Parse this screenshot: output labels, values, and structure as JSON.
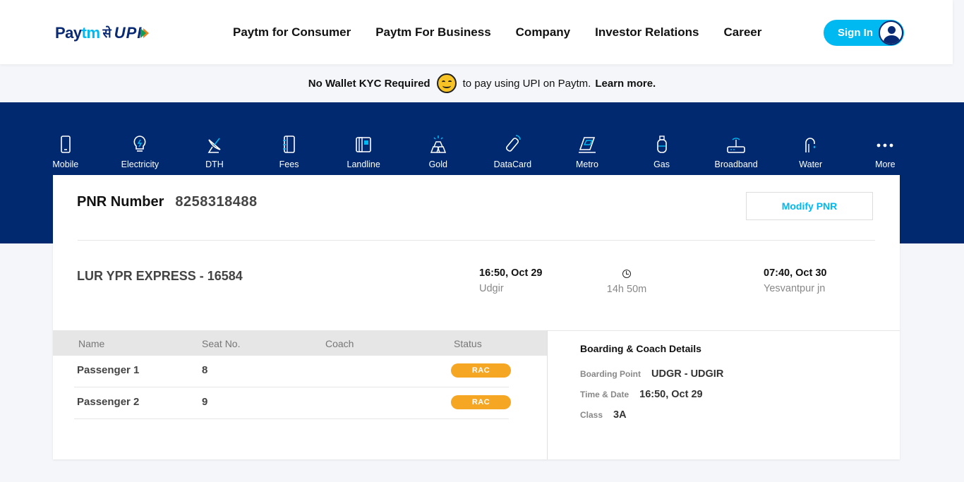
{
  "header": {
    "logo": {
      "brand": "Pay",
      "brand_tm": "tm",
      "se": "से",
      "upi": "UPI"
    },
    "nav": [
      "Paytm for Consumer",
      "Paytm For Business",
      "Company",
      "Investor Relations",
      "Career"
    ],
    "signin_label": "Sign In"
  },
  "kyc_banner": {
    "bold_text": "No Wallet KYC Required",
    "emoji": "smiley-icon",
    "mid_text": "to pay using UPI on Paytm.",
    "link_text": "Learn more."
  },
  "categories": [
    {
      "label": "Mobile",
      "icon": "mobile-icon"
    },
    {
      "label": "Electricity",
      "icon": "bulb-icon"
    },
    {
      "label": "DTH",
      "icon": "satellite-dish-icon"
    },
    {
      "label": "Fees",
      "icon": "notebook-icon"
    },
    {
      "label": "Landline",
      "icon": "landline-icon"
    },
    {
      "label": "Gold",
      "icon": "gold-icon"
    },
    {
      "label": "DataCard",
      "icon": "datacard-icon"
    },
    {
      "label": "Metro",
      "icon": "metro-icon"
    },
    {
      "label": "Gas",
      "icon": "gas-cylinder-icon"
    },
    {
      "label": "Broadband",
      "icon": "router-icon"
    },
    {
      "label": "Water",
      "icon": "water-tap-icon"
    },
    {
      "label": "More",
      "icon": "more-dots-icon"
    }
  ],
  "pnr": {
    "label": "PNR Number",
    "value": "8258318488",
    "modify_label": "Modify PNR"
  },
  "journey": {
    "train": "LUR YPR EXPRESS - 16584",
    "departure_time": "16:50, Oct 29",
    "departure_station": "Udgir",
    "duration": "14h 50m",
    "arrival_time": "07:40, Oct 30",
    "arrival_station": "Yesvantpur jn"
  },
  "passenger_table": {
    "headers": [
      "Name",
      "Seat No.",
      "Coach",
      "Status"
    ],
    "rows": [
      {
        "name": "Passenger 1",
        "seat": "8",
        "coach": "",
        "status": "RAC"
      },
      {
        "name": "Passenger 2",
        "seat": "9",
        "coach": "",
        "status": "RAC"
      }
    ],
    "status_color": "#f5a623"
  },
  "boarding": {
    "title": "Boarding & Coach Details",
    "boarding_point_label": "Boarding Point",
    "boarding_point": "UDGR - UDGIR",
    "time_date_label": "Time & Date",
    "time_date": "16:50, Oct 29",
    "class_label": "Class",
    "class": "3A"
  },
  "colors": {
    "brand_navy": "#002970",
    "accent_cyan": "#00b9f1",
    "rac_orange": "#f5a623"
  }
}
